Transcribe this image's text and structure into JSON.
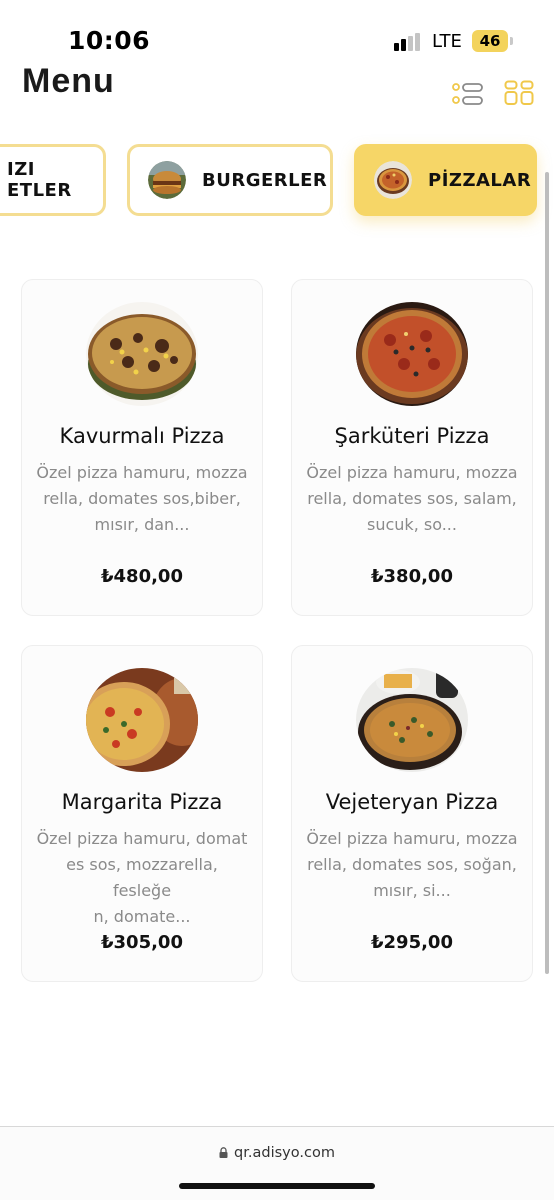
{
  "status_bar": {
    "time": "10:06",
    "network": "LTE",
    "battery": "46"
  },
  "header": {
    "title": "Menu"
  },
  "categories": [
    {
      "label": "IZI ETLER",
      "active": false
    },
    {
      "label": "BURGERLER",
      "icon": "burger-thumbnail",
      "active": false
    },
    {
      "label": "PİZZALAR",
      "icon": "pizza-thumbnail",
      "active": true
    }
  ],
  "products": [
    {
      "name": "Kavurmalı Pizza",
      "desc_lines": [
        "Özel pizza hamuru, mozza",
        "rella, domates sos,biber,",
        "mısır, dan..."
      ],
      "price": "₺480,00"
    },
    {
      "name": "Şarküteri Pizza",
      "desc_lines": [
        "Özel pizza hamuru, mozza",
        "rella, domates sos, salam,",
        "sucuk, so..."
      ],
      "price": "₺380,00"
    },
    {
      "name": "Margarita Pizza",
      "desc_lines": [
        "Özel pizza hamuru, domat",
        "es sos, mozzarella, fesleğe",
        "n, domate..."
      ],
      "price": "₺305,00"
    },
    {
      "name": "Vejeteryan Pizza",
      "desc_lines": [
        "Özel pizza hamuru, mozza",
        "rella, domates sos, soğan,",
        "mısır, si..."
      ],
      "price": "₺295,00"
    }
  ],
  "browser": {
    "url": "qr.adisyo.com"
  },
  "colors": {
    "accent": "#f6d667",
    "category_border": "#f4dd92",
    "description_text": "#8a8a8a"
  }
}
